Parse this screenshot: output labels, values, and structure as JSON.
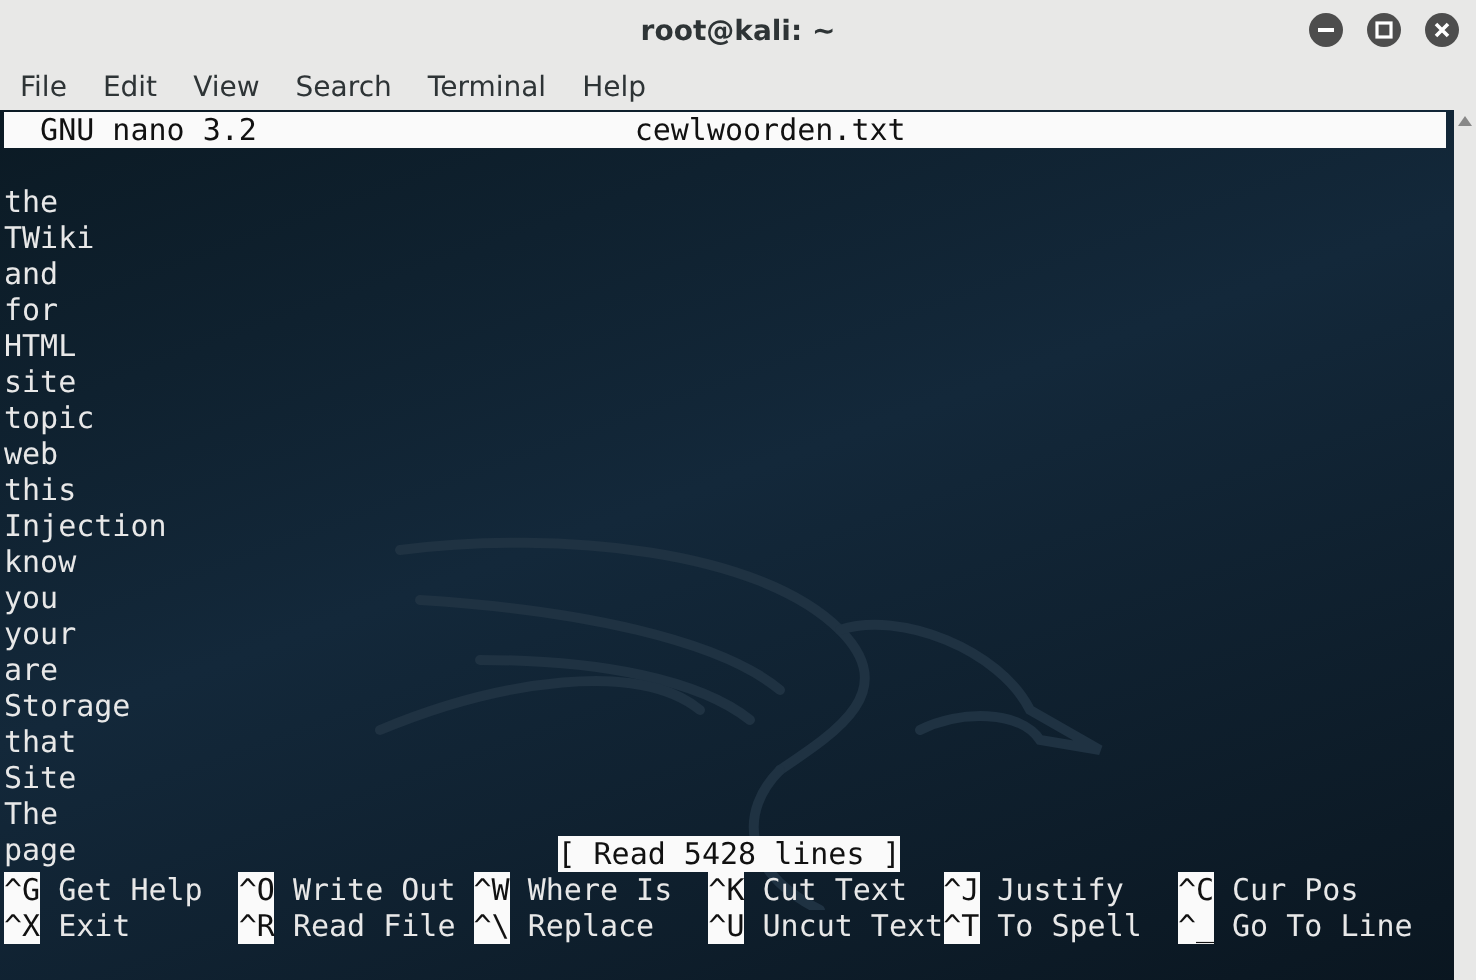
{
  "window": {
    "title": "root@kali: ~"
  },
  "menu": [
    "File",
    "Edit",
    "View",
    "Search",
    "Terminal",
    "Help"
  ],
  "nano_header": {
    "version": "GNU nano 3.2",
    "filename": "cewlwoorden.txt"
  },
  "lines": [
    "the",
    "TWiki",
    "and",
    "for",
    "HTML",
    "site",
    "topic",
    "web",
    "this",
    "Injection",
    "know",
    "you",
    "your",
    "are",
    "Storage",
    "that",
    "Site",
    "The",
    "page"
  ],
  "status": "[ Read 5428 lines ]",
  "shortcuts": [
    [
      {
        "key": "^G",
        "label": "Get Help"
      },
      {
        "key": "^O",
        "label": "Write Out"
      },
      {
        "key": "^W",
        "label": "Where Is"
      },
      {
        "key": "^K",
        "label": "Cut Text"
      },
      {
        "key": "^J",
        "label": "Justify"
      },
      {
        "key": "^C",
        "label": "Cur Pos"
      }
    ],
    [
      {
        "key": "^X",
        "label": "Exit"
      },
      {
        "key": "^R",
        "label": "Read File"
      },
      {
        "key": "^\\",
        "label": "Replace"
      },
      {
        "key": "^U",
        "label": "Uncut Text"
      },
      {
        "key": "^T",
        "label": "To Spell"
      },
      {
        "key": "^_",
        "label": "Go To Line"
      }
    ]
  ]
}
